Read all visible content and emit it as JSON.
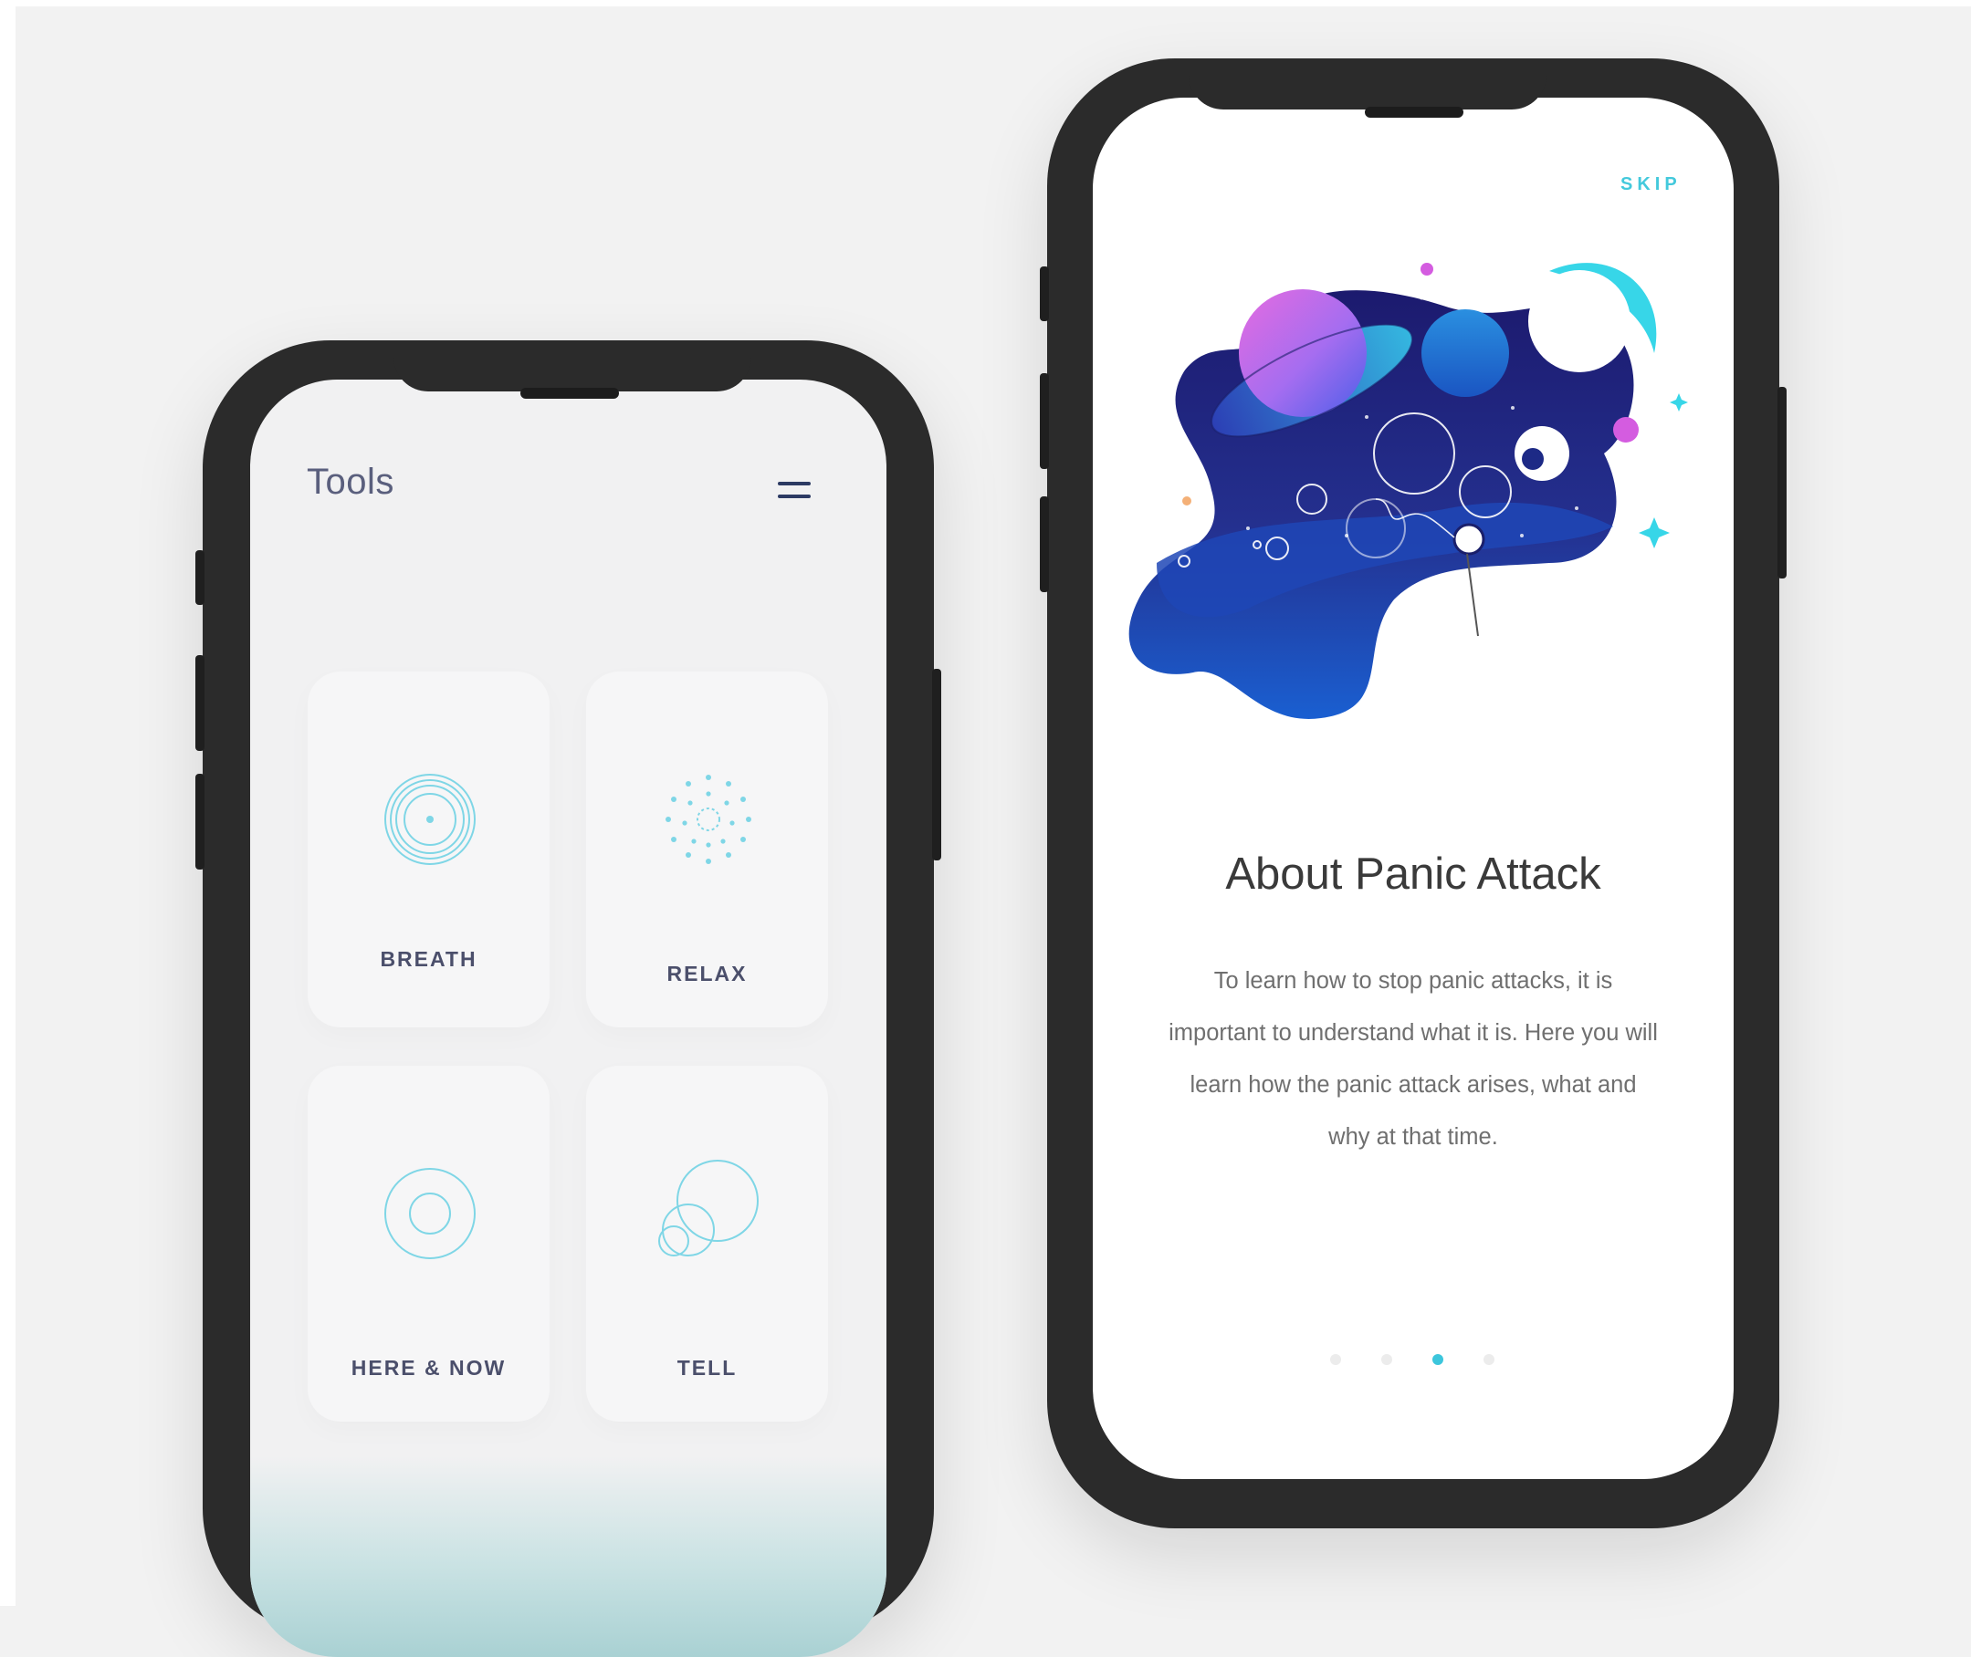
{
  "tools_screen": {
    "title": "Tools",
    "menu_icon": "hamburger-menu-icon",
    "cards": [
      {
        "label": "BREATH",
        "icon": "concentric-rings-icon"
      },
      {
        "label": "RELAX",
        "icon": "dotted-burst-icon"
      },
      {
        "label": "HERE & NOW",
        "icon": "target-circle-icon"
      },
      {
        "label": "TELL",
        "icon": "overlapping-circles-icon"
      }
    ]
  },
  "onboarding_screen": {
    "skip_label": "SKIP",
    "illustration": "space-planets-illustration",
    "headline": "About Panic Attack",
    "body": "To learn how to stop panic attacks, it is important to understand what it is. Here you will learn how the panic attack arises, what and why at that time.",
    "pager": {
      "count": 4,
      "active_index": 2
    }
  },
  "colors": {
    "accent": "#3cc6dc",
    "icon_line": "#7fd6e6",
    "title_text": "#5a5f7d",
    "label_text": "#4b4f6b",
    "phone_frame": "#2b2b2b",
    "background": "#f2f2f2"
  }
}
